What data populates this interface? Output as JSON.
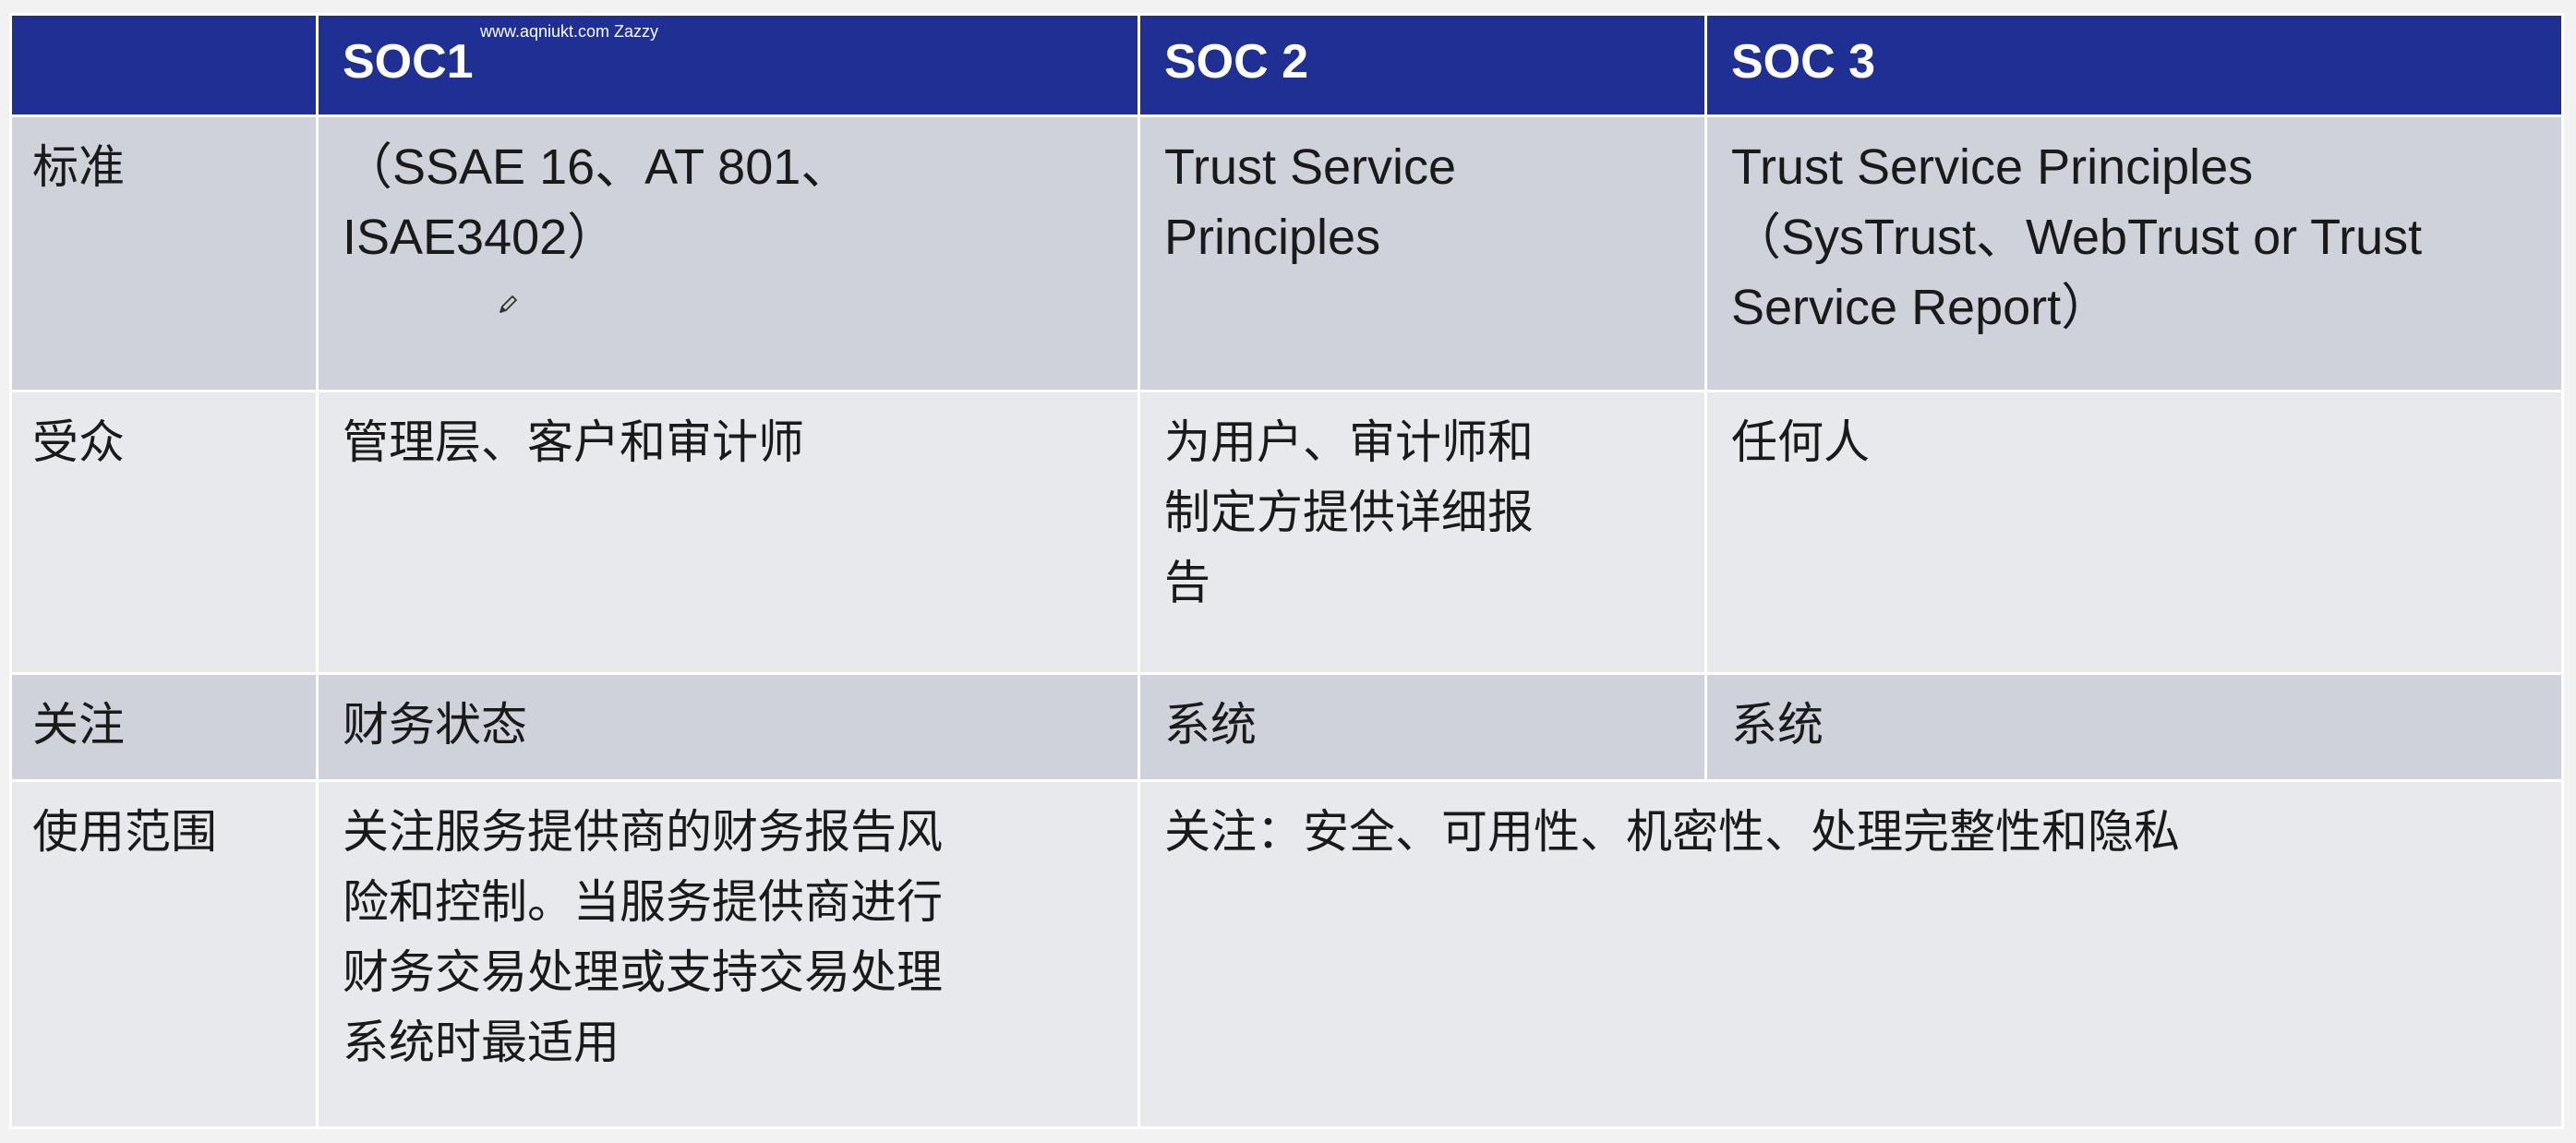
{
  "header": {
    "blank": "",
    "soc1": "SOC1",
    "soc2": "SOC 2",
    "soc3": "SOC 3",
    "watermark": "www.aqniukt.com Zazzy"
  },
  "rows": [
    {
      "label": "标准",
      "soc1": "（SSAE 16、AT 801、\nISAE3402）",
      "soc2": "Trust Service\nPrinciples",
      "soc3": "Trust Service Principles\n（SysTrust、WebTrust or Trust\nService Report）"
    },
    {
      "label": "受众",
      "soc1": "管理层、客户和审计师",
      "soc2": "为用户、审计师和\n制定方提供详细报\n告",
      "soc3": "任何人"
    },
    {
      "label": "关注",
      "soc1": "财务状态",
      "soc2": "系统",
      "soc3": "系统"
    },
    {
      "label": "使用范围",
      "soc1": "关注服务提供商的财务报告风\n险和控制。当服务提供商进行\n财务交易处理或支持交易处理\n系统时最适用",
      "soc2_3": "关注：安全、可用性、机密性、处理完整性和隐私"
    }
  ],
  "icons": {
    "cursor": "pencil-icon"
  }
}
